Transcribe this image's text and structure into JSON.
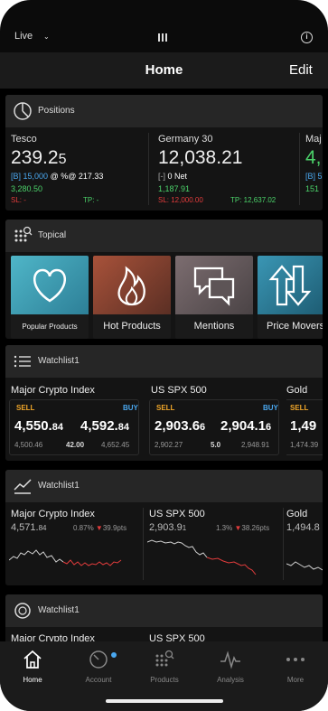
{
  "status": {
    "live_label": "Live"
  },
  "header": {
    "title": "Home",
    "edit_label": "Edit"
  },
  "positions": {
    "title": "Positions",
    "items": [
      {
        "name": "Tesco",
        "price_main": "239.2",
        "price_tail": "5",
        "line1_bracket": "[B]",
        "line1_qty": "15,000",
        "line1_rest": "@ %@ 217.33",
        "pnl": "3,280.50",
        "sl": "SL: -",
        "tp": "TP: -"
      },
      {
        "name": "Germany 30",
        "price_main": "12,038.21",
        "price_tail": "",
        "line1_bracket": "[-]",
        "line1_qty": "0 Net",
        "line1_rest": "",
        "pnl": "1,187.91",
        "sl": "SL: 12,000.00",
        "tp": "TP: 12,637.02"
      },
      {
        "name": "Maj",
        "price_main": "4,",
        "line1": "[B] 5",
        "pnl": "151"
      }
    ]
  },
  "topical": {
    "title": "Topical",
    "tiles": [
      {
        "label": "Popular Products",
        "icon": "heart-icon"
      },
      {
        "label": "Hot Products",
        "icon": "flame-icon"
      },
      {
        "label": "Mentions",
        "icon": "speech-bubbles-icon"
      },
      {
        "label": "Price Movers",
        "icon": "up-down-arrows-icon"
      }
    ]
  },
  "watchlist_prices": {
    "title": "Watchlist1",
    "cards": [
      {
        "name": "Major Crypto Index",
        "sell_label": "SELL",
        "buy_label": "BUY",
        "sell_main": "4,550.",
        "sell_small": "84",
        "buy_main": "4,592.",
        "buy_small": "84",
        "low": "4,500.46",
        "spread": "42.00",
        "high": "4,652.45"
      },
      {
        "name": "US SPX 500",
        "sell_label": "SELL",
        "buy_label": "BUY",
        "sell_main": "2,903.6",
        "sell_small": "6",
        "buy_main": "2,904.1",
        "buy_small": "6",
        "low": "2,902.27",
        "spread": "5.0",
        "high": "2,948.91"
      },
      {
        "name": "Gold",
        "sell_label": "SELL",
        "sell_main": "1,49",
        "low": "1,474.39"
      }
    ]
  },
  "watchlist_charts": {
    "title": "Watchlist1",
    "cards": [
      {
        "name": "Major Crypto Index",
        "price": "4,571.",
        "price_small": "84",
        "change": "0.87%",
        "change_pts": "39.9pts"
      },
      {
        "name": "US SPX 500",
        "price": "2,903.9",
        "price_small": "1",
        "change": "1.3%",
        "change_pts": "38.26pts"
      },
      {
        "name": "Gold",
        "price": "1,494.8"
      }
    ]
  },
  "watchlist_third": {
    "title": "Watchlist1",
    "cards": [
      {
        "name": "Major Crypto Index"
      },
      {
        "name": "US SPX 500"
      }
    ]
  },
  "tabbar": {
    "items": [
      {
        "label": "Home",
        "icon": "home-icon"
      },
      {
        "label": "Account",
        "icon": "account-icon"
      },
      {
        "label": "Products",
        "icon": "products-icon"
      },
      {
        "label": "Analysis",
        "icon": "analysis-icon"
      },
      {
        "label": "More",
        "icon": "more-icon"
      }
    ]
  },
  "colors": {
    "accent_blue": "#4aa8f0",
    "green": "#4bd26a",
    "red": "#e23c3c",
    "sell_orange": "#f0a629"
  }
}
